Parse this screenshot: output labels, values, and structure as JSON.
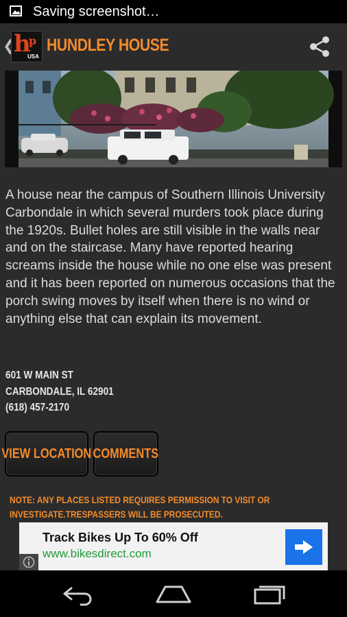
{
  "status_bar": {
    "notification_icon": "image-icon",
    "text": "Saving screenshot…"
  },
  "action_bar": {
    "up_icon": "chevron-left-icon",
    "logo": {
      "main": "h",
      "sup": "p",
      "sub": "USA"
    },
    "title": "HUNDLEY HOUSE",
    "share_icon": "share-icon"
  },
  "content": {
    "photo_alt": "house-photo",
    "description": "A house near the campus of Southern Illinois University Carbondale in which several murders took place during the 1920s. Bullet holes are still visible in the walls near and on the staircase. Many have reported hearing screams inside the house while no one else was present and it has been reported on numerous occasions that the porch swing moves by itself when there is no wind or anything else that can explain its movement.",
    "address": {
      "street": "601 W MAIN ST",
      "city": "CARBONDALE, IL 62901",
      "phone": "(618) 457-2170"
    },
    "buttons": {
      "view_location": "VIEW LOCATION",
      "comments": "COMMENTS"
    },
    "note_line1": "NOTE: ANY PLACES LISTED REQUIRES PERMISSION TO VISIT OR",
    "note_line2": "INVESTIGATE.TRESPASSERS WILL BE PROSECUTED."
  },
  "ad": {
    "title": "Track Bikes Up To 60% Off",
    "url": "www.bikesdirect.com",
    "arrow_icon": "arrow-right-icon",
    "info_icon": "info-icon"
  },
  "nav_bar": {
    "back_icon": "back-icon",
    "home_icon": "home-icon",
    "recents_icon": "recents-icon"
  },
  "colors": {
    "accent": "#f28b2c",
    "background": "#2b2b2b",
    "ad_url": "#1f9a3a",
    "ad_button": "#1a73e8"
  }
}
